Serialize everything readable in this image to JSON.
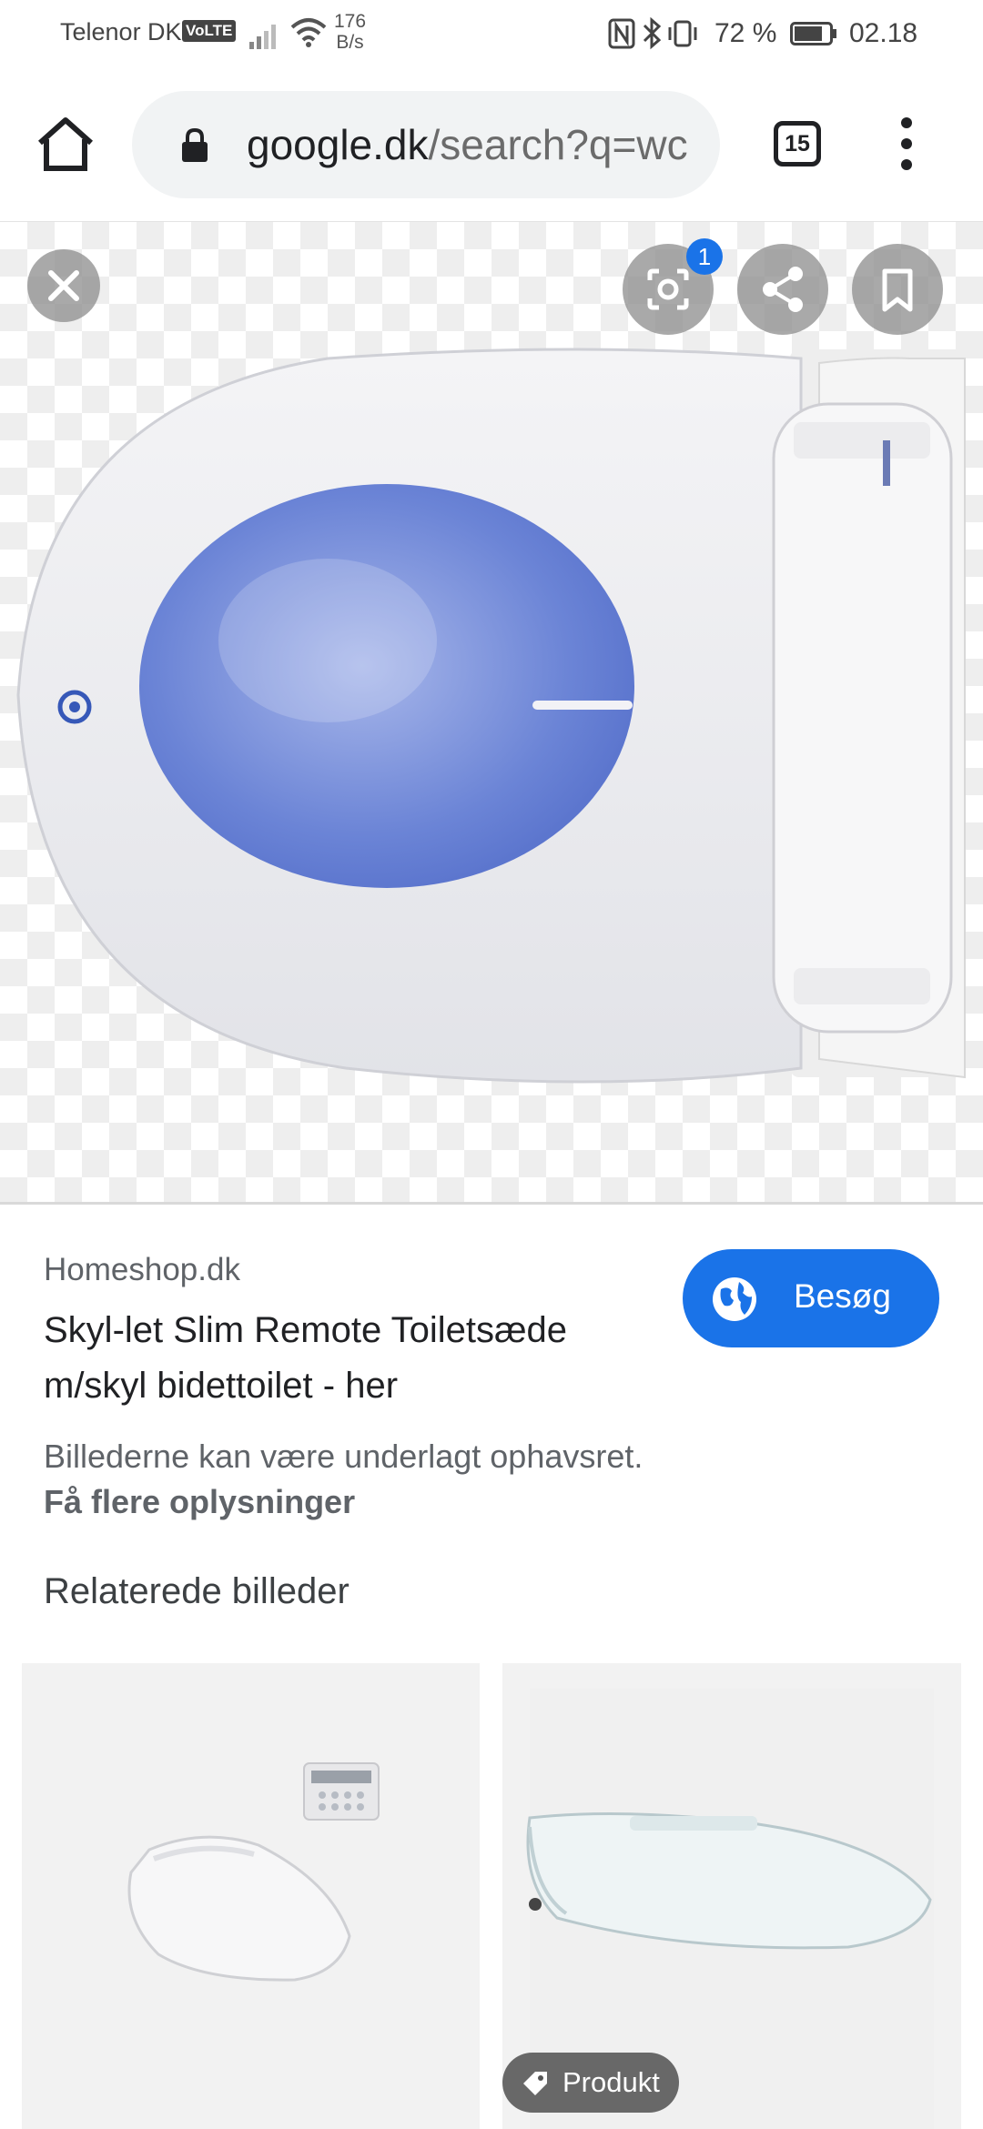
{
  "status_bar": {
    "carrier": "Telenor DK",
    "volte": "VoLTE",
    "speed_value": "176",
    "speed_unit": "B/s",
    "battery_percent": "72 %",
    "time": "02.18",
    "icons": [
      "signal-icon",
      "wifi-icon",
      "nfc-icon",
      "bluetooth-icon",
      "vibrate-icon",
      "battery-icon"
    ]
  },
  "browser": {
    "url_domain": "google.dk",
    "url_path": "/search?q=wc",
    "tab_count": "15",
    "icons": [
      "home-icon",
      "lock-icon",
      "tabs-icon",
      "more-vert-icon"
    ]
  },
  "viewer": {
    "lens_badge": "1",
    "icons": [
      "close-icon",
      "lens-icon",
      "share-icon",
      "bookmark-icon"
    ]
  },
  "result": {
    "source": "Homeshop.dk",
    "title": "Skyl-let Slim Remote Toiletsæde m/skyl bidettoilet - her",
    "visit_label": "Besøg",
    "copyright_notice": "Billederne kan være underlagt ophavsret.",
    "more_info_link": "Få flere oplysninger"
  },
  "related": {
    "heading": "Relaterede billeder",
    "product_chip": "Produkt"
  },
  "colors": {
    "accent": "#1a73e8",
    "bowl_blue": "#6b84d6"
  }
}
